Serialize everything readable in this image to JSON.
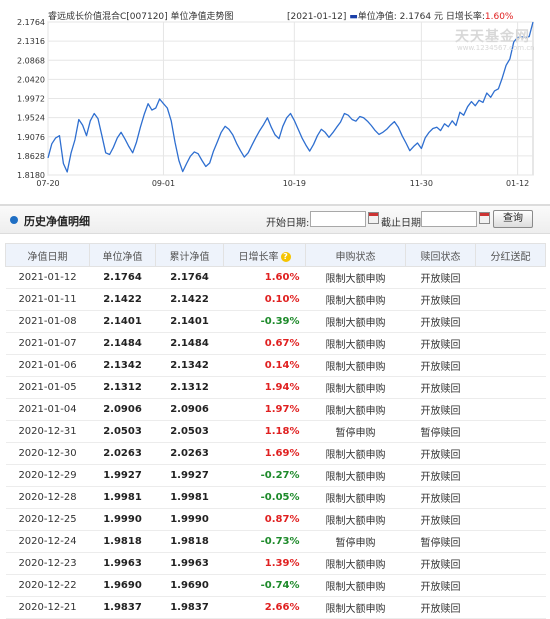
{
  "chart": {
    "title": "睿远成长价值混合C[007120] 单位净值走势图",
    "info_date": "[2021-01-12]",
    "info_marker": "▬",
    "info_nav_label": "单位净值: 2.1764 元",
    "info_growth_label": "日增长率:",
    "info_growth_value": "1.60%",
    "watermark": "天天基金网",
    "watermark_url": "www.1234567.com.cn"
  },
  "chart_data": {
    "type": "line",
    "title": "睿远成长价值混合C[007120] 单位净值走势图",
    "ylim": [
      1.818,
      2.1764
    ],
    "y_ticks": [
      "2.1764",
      "2.1316",
      "2.0868",
      "2.0420",
      "1.9972",
      "1.9524",
      "1.9076",
      "1.8628",
      "1.8180"
    ],
    "x_ticks": [
      "07-20",
      "09-01",
      "10-19",
      "11-30",
      "01-12"
    ],
    "x_tick_positions": [
      0,
      30,
      64,
      97,
      122
    ],
    "color": "#2f6fd0",
    "series": [
      {
        "values": [
          1.858,
          1.891,
          1.905,
          1.91,
          1.845,
          1.825,
          1.87,
          1.9,
          1.948,
          1.935,
          1.91,
          1.945,
          1.962,
          1.95,
          1.91,
          1.87,
          1.866,
          1.883,
          1.905,
          1.918,
          1.902,
          1.885,
          1.87,
          1.895,
          1.93,
          1.96,
          1.985,
          1.97,
          1.975,
          1.996,
          1.985,
          1.975,
          1.945,
          1.895,
          1.852,
          1.826,
          1.845,
          1.862,
          1.872,
          1.868,
          1.852,
          1.838,
          1.846,
          1.874,
          1.896,
          1.918,
          1.932,
          1.925,
          1.912,
          1.892,
          1.875,
          1.86,
          1.87,
          1.888,
          1.906,
          1.922,
          1.936,
          1.952,
          1.93,
          1.912,
          1.903,
          1.932,
          1.952,
          1.962,
          1.946,
          1.925,
          1.905,
          1.888,
          1.874,
          1.89,
          1.91,
          1.925,
          1.918,
          1.906,
          1.917,
          1.93,
          1.942,
          1.962,
          1.958,
          1.948,
          1.944,
          1.955,
          1.952,
          1.944,
          1.934,
          1.922,
          1.913,
          1.918,
          1.925,
          1.935,
          1.943,
          1.93,
          1.91,
          1.893,
          1.875,
          1.885,
          1.893,
          1.88,
          1.905,
          1.918,
          1.927,
          1.93,
          1.922,
          1.938,
          1.931,
          1.945,
          1.934,
          1.965,
          1.958,
          1.978,
          1.99,
          1.98,
          1.993,
          1.988,
          2.01,
          2.0,
          2.015,
          2.02,
          2.045,
          2.075,
          2.09,
          2.13,
          2.14,
          2.142,
          2.1401,
          2.1422,
          2.1764
        ]
      }
    ]
  },
  "section": {
    "title": "历史净值明细",
    "start_label": "开始日期:",
    "end_label": "截止日期:",
    "start_value": "",
    "end_value": "",
    "query_button": "查询"
  },
  "table": {
    "headers": [
      "净值日期",
      "单位净值",
      "累计净值",
      "日增长率",
      "申购状态",
      "赎回状态",
      "分红送配"
    ],
    "help_icon": "?",
    "rows": [
      {
        "date": "2021-01-12",
        "nav": "2.1764",
        "acc": "2.1764",
        "pct": "1.60%",
        "dir": "up",
        "buy": "限制大额申购",
        "sell": "开放赎回",
        "div": ""
      },
      {
        "date": "2021-01-11",
        "nav": "2.1422",
        "acc": "2.1422",
        "pct": "0.10%",
        "dir": "up",
        "buy": "限制大额申购",
        "sell": "开放赎回",
        "div": ""
      },
      {
        "date": "2021-01-08",
        "nav": "2.1401",
        "acc": "2.1401",
        "pct": "-0.39%",
        "dir": "down",
        "buy": "限制大额申购",
        "sell": "开放赎回",
        "div": ""
      },
      {
        "date": "2021-01-07",
        "nav": "2.1484",
        "acc": "2.1484",
        "pct": "0.67%",
        "dir": "up",
        "buy": "限制大额申购",
        "sell": "开放赎回",
        "div": ""
      },
      {
        "date": "2021-01-06",
        "nav": "2.1342",
        "acc": "2.1342",
        "pct": "0.14%",
        "dir": "up",
        "buy": "限制大额申购",
        "sell": "开放赎回",
        "div": ""
      },
      {
        "date": "2021-01-05",
        "nav": "2.1312",
        "acc": "2.1312",
        "pct": "1.94%",
        "dir": "up",
        "buy": "限制大额申购",
        "sell": "开放赎回",
        "div": ""
      },
      {
        "date": "2021-01-04",
        "nav": "2.0906",
        "acc": "2.0906",
        "pct": "1.97%",
        "dir": "up",
        "buy": "限制大额申购",
        "sell": "开放赎回",
        "div": ""
      },
      {
        "date": "2020-12-31",
        "nav": "2.0503",
        "acc": "2.0503",
        "pct": "1.18%",
        "dir": "up",
        "buy": "暂停申购",
        "sell": "暂停赎回",
        "div": ""
      },
      {
        "date": "2020-12-30",
        "nav": "2.0263",
        "acc": "2.0263",
        "pct": "1.69%",
        "dir": "up",
        "buy": "限制大额申购",
        "sell": "开放赎回",
        "div": ""
      },
      {
        "date": "2020-12-29",
        "nav": "1.9927",
        "acc": "1.9927",
        "pct": "-0.27%",
        "dir": "down",
        "buy": "限制大额申购",
        "sell": "开放赎回",
        "div": ""
      },
      {
        "date": "2020-12-28",
        "nav": "1.9981",
        "acc": "1.9981",
        "pct": "-0.05%",
        "dir": "down",
        "buy": "限制大额申购",
        "sell": "开放赎回",
        "div": ""
      },
      {
        "date": "2020-12-25",
        "nav": "1.9990",
        "acc": "1.9990",
        "pct": "0.87%",
        "dir": "up",
        "buy": "限制大额申购",
        "sell": "开放赎回",
        "div": ""
      },
      {
        "date": "2020-12-24",
        "nav": "1.9818",
        "acc": "1.9818",
        "pct": "-0.73%",
        "dir": "down",
        "buy": "暂停申购",
        "sell": "暂停赎回",
        "div": ""
      },
      {
        "date": "2020-12-23",
        "nav": "1.9963",
        "acc": "1.9963",
        "pct": "1.39%",
        "dir": "up",
        "buy": "限制大额申购",
        "sell": "开放赎回",
        "div": ""
      },
      {
        "date": "2020-12-22",
        "nav": "1.9690",
        "acc": "1.9690",
        "pct": "-0.74%",
        "dir": "down",
        "buy": "限制大额申购",
        "sell": "开放赎回",
        "div": ""
      },
      {
        "date": "2020-12-21",
        "nav": "1.9837",
        "acc": "1.9837",
        "pct": "2.66%",
        "dir": "up",
        "buy": "限制大额申购",
        "sell": "开放赎回",
        "div": ""
      }
    ]
  }
}
